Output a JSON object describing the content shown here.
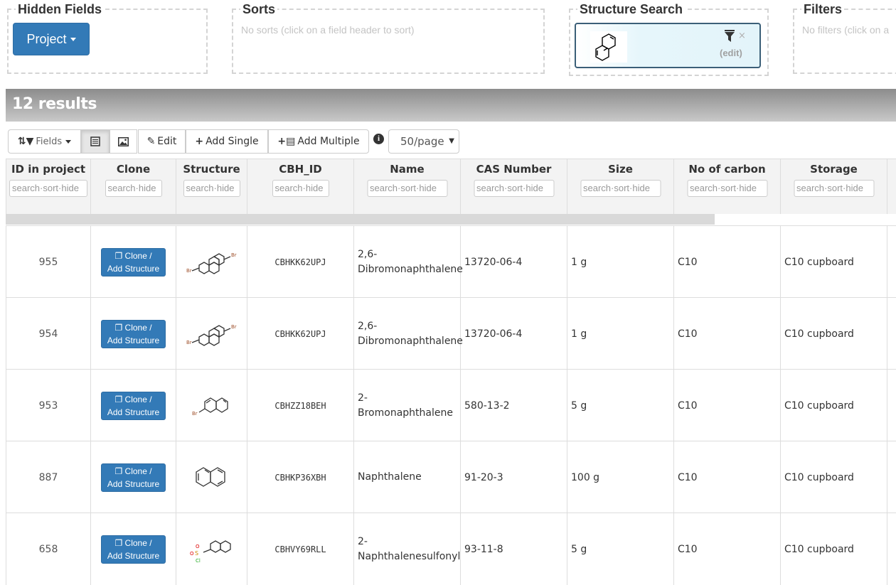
{
  "panels": {
    "hidden_fields": {
      "title": "Hidden Fields",
      "button": "Project"
    },
    "sorts": {
      "title": "Sorts",
      "hint": "No sorts (click on a field header to sort)"
    },
    "structure_search": {
      "title": "Structure Search",
      "close": "×",
      "edit": "(edit)"
    },
    "filters": {
      "title": "Filters",
      "hint": "No filters (click on a"
    }
  },
  "results": {
    "label": "12 results"
  },
  "toolbar": {
    "fields": "Fields",
    "edit": "Edit",
    "add_single": "Add Single",
    "add_multiple": "Add Multiple",
    "info": "i",
    "per_page": "50/page"
  },
  "table": {
    "columns": [
      {
        "title": "ID in project",
        "filter": "search·sort·hide"
      },
      {
        "title": "Clone",
        "filter": "search·hide"
      },
      {
        "title": "Structure",
        "filter": "search·hide"
      },
      {
        "title": "CBH_ID",
        "filter": "search·hide"
      },
      {
        "title": "Name",
        "filter": "search·sort·hide"
      },
      {
        "title": "CAS Number",
        "filter": "search·sort·hide"
      },
      {
        "title": "Size",
        "filter": "search·sort·hide"
      },
      {
        "title": "No of carbon",
        "filter": "search·sort·hide"
      },
      {
        "title": "Storage",
        "filter": "search·sort·hide"
      }
    ],
    "clone_label_1": "Clone /",
    "clone_label_2": "Add Structure",
    "rows": [
      {
        "id": "955",
        "cbh_id": "CBHKK62UPJ",
        "name1": "2,6-",
        "name2": "Dibromonaphthalene",
        "cas": "13720-06-4",
        "size": "1 g",
        "carbon": "C10",
        "storage": "C10 cupboard",
        "mol": "dibromo"
      },
      {
        "id": "954",
        "cbh_id": "CBHKK62UPJ",
        "name1": "2,6-",
        "name2": "Dibromonaphthalene",
        "cas": "13720-06-4",
        "size": "1 g",
        "carbon": "C10",
        "storage": "C10 cupboard",
        "mol": "dibromo"
      },
      {
        "id": "953",
        "cbh_id": "CBHZZ18BEH",
        "name1": "2-",
        "name2": "Bromonaphthalene",
        "cas": "580-13-2",
        "size": "5 g",
        "carbon": "C10",
        "storage": "C10 cupboard",
        "mol": "bromo"
      },
      {
        "id": "887",
        "cbh_id": "CBHKP36XBH",
        "name1": "Naphthalene",
        "name2": "",
        "cas": "91-20-3",
        "size": "100 g",
        "carbon": "C10",
        "storage": "C10 cupboard",
        "mol": "naph"
      },
      {
        "id": "658",
        "cbh_id": "CBHVY69RLL",
        "name1": "2-",
        "name2": "Naphthalenesulfonyl",
        "cas": "93-11-8",
        "size": "5 g",
        "carbon": "C10",
        "storage": "C10 cupboard",
        "mol": "sulfonyl"
      }
    ]
  }
}
